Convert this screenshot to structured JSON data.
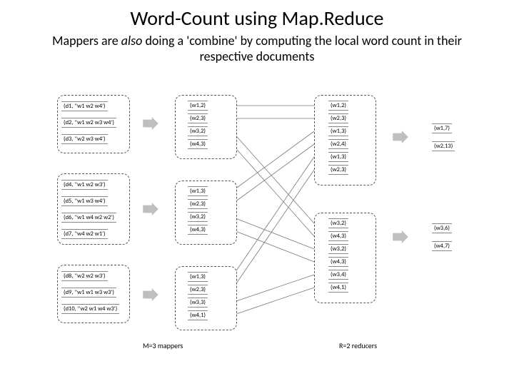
{
  "title": "Word-Count using Map.Reduce",
  "subtitle_before": "Mappers are ",
  "subtitle_italic": "also",
  "subtitle_after": " doing a 'combine' by computing the local word count in their respective documents",
  "inputs": {
    "g1": [
      "(d1, ''w1 w2 w4')",
      "(d2, ''w1 w2 w3 w4')",
      "(d3, ''w2 w3 w4')"
    ],
    "g2": [
      "(d4, ''w1 w2 w3')",
      "(d5, ''w1 w3 w4')",
      "(d6, ''w1 w4 w2 w2')",
      "(d7, ''w4 w2 w1')"
    ],
    "g3": [
      "(d8, ''w2 w2 w3')",
      "(d9, ''w1 w1 w3 w3')",
      "(d10, ''w2 w1 w4 w3')"
    ]
  },
  "combined": {
    "c1": [
      "(w1,2)",
      "(w2,3)",
      "(w3,2)",
      "(w4,3)"
    ],
    "c2": [
      "(w1,3)",
      "(w2,3)",
      "(w3,2)",
      "(w4,3)"
    ],
    "c3": [
      "(w1,3)",
      "(w2,3)",
      "(w3,3)",
      "(w4,1)"
    ]
  },
  "reduce_in": {
    "r1": [
      "(w1,2)",
      "(w2,3)",
      "(w1,3)",
      "(w2,4)",
      "(w1,3)",
      "(w2,3)"
    ],
    "r2": [
      "(w3,2)",
      "(w4,3)",
      "(w3,2)",
      "(w4,3)",
      "(w3,4)",
      "(w4,1)"
    ]
  },
  "output": {
    "o1": [
      "(w1,7)",
      "(w2,13)"
    ],
    "o2": [
      "(w3,6)",
      "(w4,7)"
    ]
  },
  "label_mappers": "M=3 mappers",
  "label_reducers": "R=2 reducers",
  "chart_data": {
    "type": "diagram",
    "mappers": 3,
    "reducers": 2,
    "input_docs": [
      {
        "doc": "d1",
        "words": [
          "w1",
          "w2",
          "w4"
        ]
      },
      {
        "doc": "d2",
        "words": [
          "w1",
          "w2",
          "w3",
          "w4"
        ]
      },
      {
        "doc": "d3",
        "words": [
          "w2",
          "w3",
          "w4"
        ]
      },
      {
        "doc": "d4",
        "words": [
          "w1",
          "w2",
          "w3"
        ]
      },
      {
        "doc": "d5",
        "words": [
          "w1",
          "w3",
          "w4"
        ]
      },
      {
        "doc": "d6",
        "words": [
          "w1",
          "w4",
          "w2",
          "w2"
        ]
      },
      {
        "doc": "d7",
        "words": [
          "w4",
          "w2",
          "w1"
        ]
      },
      {
        "doc": "d8",
        "words": [
          "w2",
          "w2",
          "w3"
        ]
      },
      {
        "doc": "d9",
        "words": [
          "w1",
          "w1",
          "w3",
          "w3"
        ]
      },
      {
        "doc": "d10",
        "words": [
          "w2",
          "w1",
          "w4",
          "w3"
        ]
      }
    ],
    "mapper_output": [
      {
        "mapper": 1,
        "counts": {
          "w1": 2,
          "w2": 3,
          "w3": 2,
          "w4": 3
        }
      },
      {
        "mapper": 2,
        "counts": {
          "w1": 3,
          "w2": 3,
          "w3": 2,
          "w4": 3
        }
      },
      {
        "mapper": 3,
        "counts": {
          "w1": 3,
          "w2": 3,
          "w3": 3,
          "w4": 1
        }
      }
    ],
    "reducer_input": [
      {
        "reducer": 1,
        "pairs": [
          [
            "w1",
            2
          ],
          [
            "w2",
            3
          ],
          [
            "w1",
            3
          ],
          [
            "w2",
            4
          ],
          [
            "w1",
            3
          ],
          [
            "w2",
            3
          ]
        ]
      },
      {
        "reducer": 2,
        "pairs": [
          [
            "w3",
            2
          ],
          [
            "w4",
            3
          ],
          [
            "w3",
            2
          ],
          [
            "w4",
            3
          ],
          [
            "w3",
            4
          ],
          [
            "w4",
            1
          ]
        ]
      }
    ],
    "final_output": {
      "w1": 7,
      "w2": 13,
      "w3": 6,
      "w4": 7
    }
  }
}
